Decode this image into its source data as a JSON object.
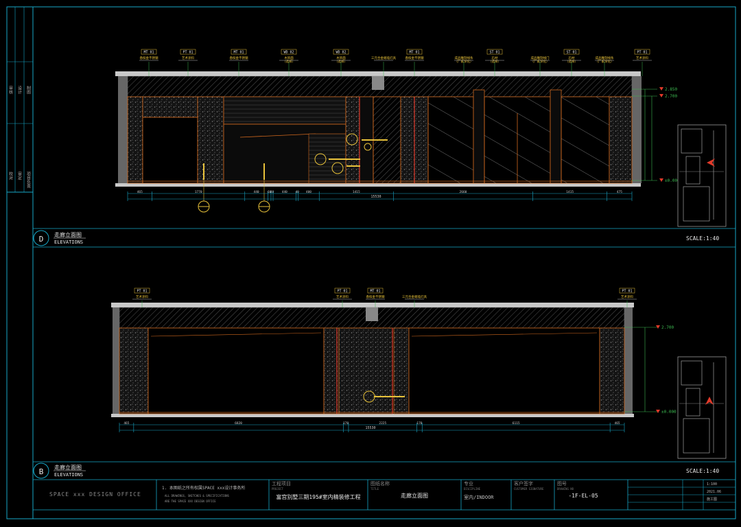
{
  "elevation_d": {
    "marker": "D",
    "title": "走廊立面图",
    "subtitle": "ELEVATIONS",
    "scale": "SCALE:1:40",
    "level_top_1": "2.850",
    "level_top_2": "2.700",
    "level_floor": "±0.000",
    "dim_total": "15530",
    "dims": [
      "465",
      "1770",
      "440",
      "60",
      "40",
      "440",
      "40",
      "400",
      "1415",
      "2660",
      "1415",
      "475"
    ],
    "callouts": [
      {
        "code": "MT 01",
        "text": "香槟金不锈钢"
      },
      {
        "code": "PT 01",
        "text": "艺术涂料"
      },
      {
        "code": "MT 01",
        "text": "香槟金不锈钢"
      },
      {
        "code": "WD 02",
        "text": "木饰面（选样）"
      },
      {
        "code": "WD 02",
        "text": "木饰面（选样）"
      },
      {
        "code": "",
        "text": "三元合金端墙灯具"
      },
      {
        "code": "MT 01",
        "text": "香槟金不锈钢"
      },
      {
        "code": "",
        "text": "成品雕刻线条（厂家深化）"
      },
      {
        "code": "ST 01",
        "text": "石材（选样）"
      },
      {
        "code": "",
        "text": "成品雕刻线门（厂家深化）"
      },
      {
        "code": "ST 01",
        "text": "石材（选样）"
      },
      {
        "code": "",
        "text": "成品雕刻线条（厂家深化）"
      },
      {
        "code": "PT 01",
        "text": "艺术涂料"
      }
    ]
  },
  "elevation_b": {
    "marker": "B",
    "title": "走廊立面图",
    "subtitle": "ELEVATIONS",
    "scale": "SCALE:1:40",
    "level_top_1": "2.700",
    "level_floor": "±0.000",
    "dim_total": "15530",
    "dims": [
      "465",
      "6820",
      "170",
      "2225",
      "170",
      "6115",
      "465"
    ],
    "callouts": [
      {
        "code": "PT 01",
        "text": "艺术涂料"
      },
      {
        "code": "PT 01",
        "text": "艺术涂料"
      },
      {
        "code": "MT 01",
        "text": "香槟金不锈钢"
      },
      {
        "code": "",
        "text": "三元合金端墙灯具"
      },
      {
        "code": "PT 01",
        "text": "艺术涂料"
      }
    ]
  },
  "title_block": {
    "office": "SPACE xxx DESIGN OFFICE",
    "note_1": "1. 本图纸之所有权属SPACE xxx设计事务所",
    "note_2": "ALL DRAWINGS, SKETCHES & SPECIFICATIONS",
    "note_3": "ARE THE SPACE XXX DESIGN OFFICE",
    "project_label": "工程项目",
    "project_label_en": "PROJECT",
    "project_name": "富宫别墅三期195#室内精装修工程",
    "drawing_label": "图纸名称",
    "drawing_label_en": "TITLE",
    "drawing_name": "走廊立面图",
    "discipline_label": "专业",
    "discipline_label_en": "DISCIPLINE",
    "discipline": "室内/INDOOR",
    "client_label": "客户签字",
    "client_label_en": "CUSTOMER SIGNATURE",
    "number_label": "图号",
    "number_label_en": "DRAWING NO",
    "drawing_no": "-1F-EL-05",
    "scale": "1:100",
    "date": "2021.06",
    "stage": "施工图"
  },
  "left_strip": [
    "审核",
    "设计",
    "制图",
    "校对",
    "审定",
    "项目负责"
  ],
  "colors": {
    "frame": "#17a8c8",
    "wall": "#c9c9c9",
    "orange": "#d2691e",
    "red": "#e23a2a",
    "yellow": "#e8c23a",
    "green": "#3cb850",
    "text": "#e8e8e8"
  }
}
